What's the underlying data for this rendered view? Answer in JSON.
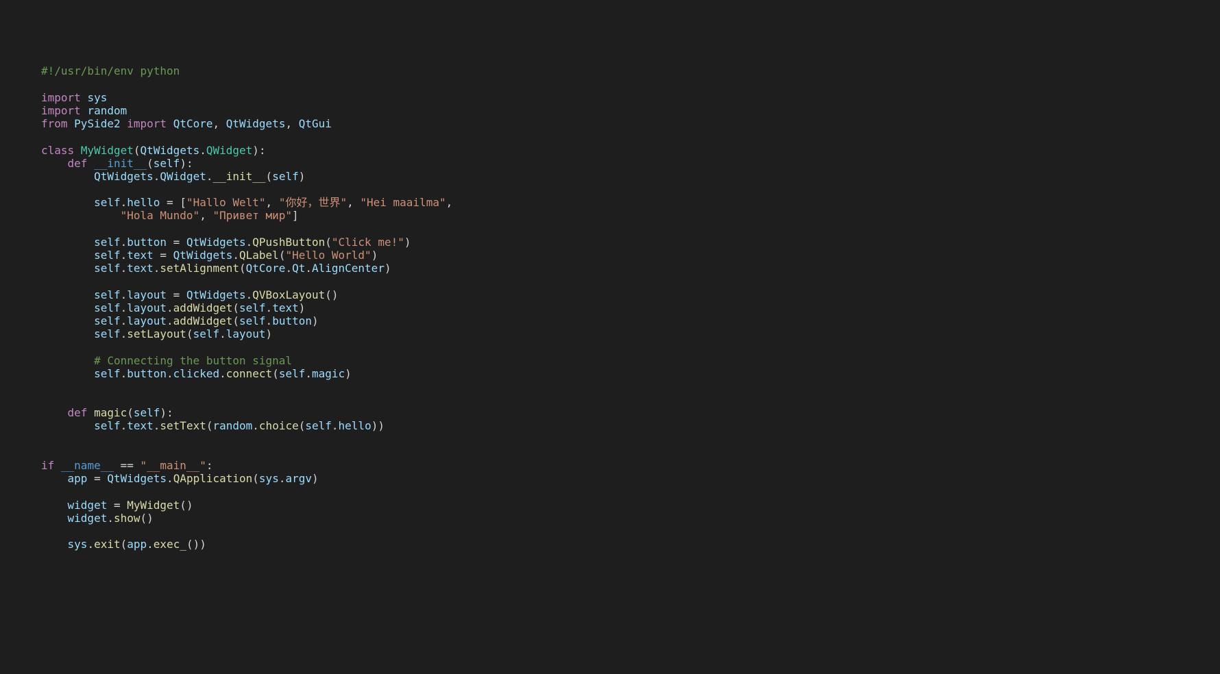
{
  "code": {
    "shebang": "#!/usr/bin/env python",
    "imp1_kw": "import",
    "sys": "sys",
    "imp2_kw": "import",
    "random": "random",
    "from_kw": "from",
    "pyside2": "PySide2",
    "imp3_kw": "import",
    "qtcore": "QtCore",
    "qtwidgets": "QtWidgets",
    "qtgui": "QtGui",
    "comma1": ", ",
    "comma2": ", ",
    "class_kw": "class",
    "mywidget": "MyWidget",
    "lparen": "(",
    "rparen": ")",
    "colon": ":",
    "qwidget": "QWidget",
    "def_kw": "def",
    "init": "__init__",
    "self": "self",
    "dot": ".",
    "hello_attr": "hello",
    "eq": " = ",
    "lbrack": "[",
    "rbrack": "]",
    "hallo_welt": "\"Hallo Welt\"",
    "nihao": "\"你好，世界\"",
    "hei": "\"Hei maailma\"",
    "hola": "\"Hola Mundo\"",
    "privet": "\"Привет мир\"",
    "button_attr": "button",
    "qpushbutton": "QPushButton",
    "click_me": "\"Click me!\"",
    "text_attr": "text",
    "qlabel": "QLabel",
    "hello_world": "\"Hello World\"",
    "setalignment": "setAlignment",
    "qt": "Qt",
    "aligncenter": "AlignCenter",
    "layout_attr": "layout",
    "qvboxlayout": "QVBoxLayout",
    "addwidget": "addWidget",
    "setlayout": "setLayout",
    "comment_connect": "# Connecting the button signal",
    "clicked": "clicked",
    "connect": "connect",
    "magic": "magic",
    "settext": "setText",
    "choice": "choice",
    "if_kw": "if",
    "name_dunder": "__name__",
    "eqeq": " == ",
    "main_str": "\"__main__\"",
    "app_var": "app",
    "qapplication": "QApplication",
    "argv": "argv",
    "widget_var": "widget",
    "show": "show",
    "exit": "exit",
    "exec": "exec_"
  }
}
